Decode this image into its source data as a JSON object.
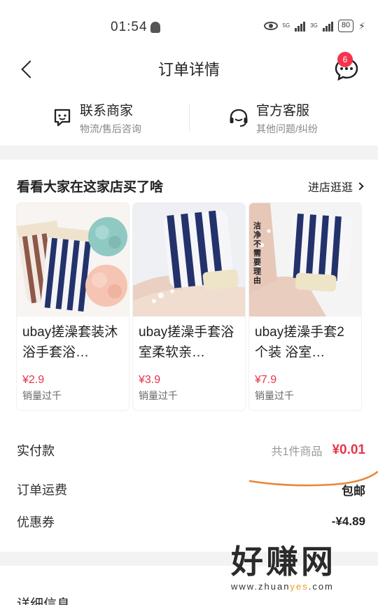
{
  "status_bar": {
    "time": "01:54",
    "net1": "5G",
    "net2": "3G",
    "battery": "80"
  },
  "nav": {
    "title": "订单详情",
    "badge_count": "6"
  },
  "contact": {
    "merchant": {
      "label": "联系商家",
      "sub": "物流/售后咨询"
    },
    "service": {
      "label": "官方客服",
      "sub": "其他问题/纠纷"
    }
  },
  "store": {
    "heading": "看看大家在这家店买了啥",
    "link": "进店逛逛",
    "products": [
      {
        "title": "ubay搓澡套装沐浴手套浴…",
        "price": "¥2.9",
        "sales": "销量过千"
      },
      {
        "title": "ubay搓澡手套浴室柔软亲…",
        "price": "¥3.9",
        "sales": "销量过千"
      },
      {
        "title": "ubay搓澡手套2个装 浴室…",
        "price": "¥7.9",
        "sales": "销量过千",
        "thumb_text": "洁净不需要理由"
      }
    ]
  },
  "payment": {
    "paid_label": "实付款",
    "item_count": "共1件商品",
    "total": "¥0.01",
    "shipping_label": "订单运费",
    "shipping_value": "包邮",
    "coupon_label": "优惠券",
    "coupon_value": "-¥4.89"
  },
  "details": {
    "title": "详细信息"
  },
  "watermark": {
    "main": "好赚网",
    "url_pre": "www.zhuan",
    "url_hl": "yes",
    "url_post": ".com"
  },
  "colors": {
    "accent": "#e8344a",
    "badge": "#f5344b",
    "scribble": "#e8873a"
  }
}
